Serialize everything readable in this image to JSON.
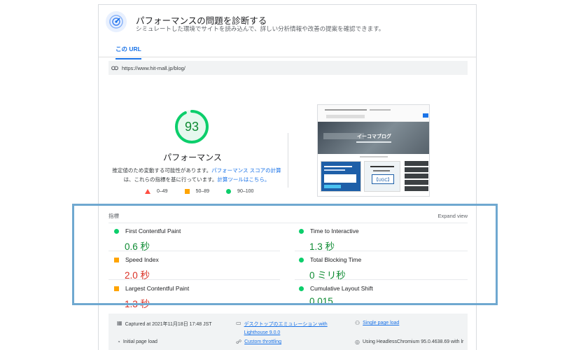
{
  "header": {
    "title": "パフォーマンスの問題を診断する",
    "subtitle": "シミュレートした環境でサイトを読み込んで、詳しい分析情報や改善の提案を確認できます。"
  },
  "tabs": [
    {
      "label": "この URL",
      "active": true
    }
  ],
  "url_bar": {
    "url": "https://www.hit-mall.jp/blog/",
    "icon": "link-icon"
  },
  "score": {
    "value": 93,
    "max": 100,
    "label": "パフォーマンス",
    "note_prefix": "推定値のため変動する可能性があります。",
    "note_link": "パフォーマンス スコアの計算",
    "note_middle": "は、これらの指標を基に行っています。",
    "note_link2": "計算ツールはこちら。",
    "color": "#0cce6b"
  },
  "legend": [
    {
      "range": "0–49",
      "shape": "triangle",
      "color": "#ff4e42"
    },
    {
      "range": "50–89",
      "shape": "square",
      "color": "#ffa400"
    },
    {
      "range": "90–100",
      "shape": "circle",
      "color": "#0cce6b"
    }
  ],
  "thumbnail": {
    "hero_text": "イーコマブログ",
    "promo_badge": "【UGC】"
  },
  "metrics": {
    "title": "指標",
    "expand_label": "Expand view",
    "items": [
      {
        "name": "First Contentful Paint",
        "value": "0.6 秒",
        "status": "good"
      },
      {
        "name": "Time to Interactive",
        "value": "1.3 秒",
        "status": "good"
      },
      {
        "name": "Speed Index",
        "value": "2.0 秒",
        "status": "average"
      },
      {
        "name": "Total Blocking Time",
        "value": "0 ミリ秒",
        "status": "good"
      },
      {
        "name": "Largest Contentful Paint",
        "value": "1.3 秒",
        "status": "average"
      },
      {
        "name": "Cumulative Layout Shift",
        "value": "0.015",
        "status": "good"
      }
    ]
  },
  "footer": {
    "captured": "Captured at 2021年11月18日 17:48 JST",
    "emulation": "デスクトップのエミュレーション with",
    "lighthouse": "Lighthouse 9.0.0",
    "single_page": "Single page load",
    "initial_load": "Initial page load",
    "throttling": "Custom throttling",
    "chromium": "Using HeadlessChromium 95.0.4638.69 with lr"
  },
  "colors": {
    "accent": "#1a73e8",
    "good": "#0cce6b",
    "good_text": "#0d8a32",
    "average": "#ffa400",
    "poor_text": "#d93025",
    "highlight_border": "#6fa8d0"
  }
}
